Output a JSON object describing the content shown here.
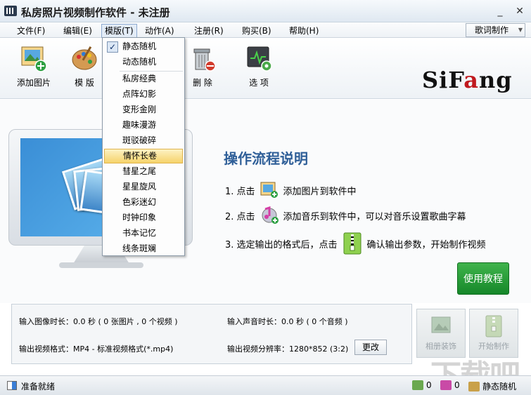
{
  "window": {
    "title": "私房照片视频制作软件 - 未注册",
    "min": "_",
    "close": "✕"
  },
  "menu": {
    "items": [
      "文件(F)",
      "编辑(E)",
      "模版(T)",
      "动作(A)",
      "注册(R)",
      "购买(B)",
      "帮助(H)"
    ],
    "lyric_button": "歌词制作"
  },
  "toolbar": {
    "add_image": "添加图片",
    "template": "模 版",
    "delete": "删 除",
    "options": "选 项"
  },
  "logo": {
    "pre": "SiF",
    "accent": "a",
    "post": "ng"
  },
  "dropdown": {
    "items": [
      "静态随机",
      "动态随机",
      "私房经典",
      "点阵幻影",
      "变形金刚",
      "趣味漫游",
      "斑驳破碎",
      "情怀长卷",
      "彗星之尾",
      "星星旋风",
      "色彩迷幻",
      "时钟印象",
      "书本记忆",
      "线条斑斓"
    ],
    "checked_index": 0,
    "highlighted_index": 7
  },
  "flow": {
    "title": "操作流程说明",
    "step1_prefix": "1. 点击",
    "step1_suffix": "添加图片到软件中",
    "step2_prefix": "2. 点击",
    "step2_suffix": "添加音乐到软件中，可以对音乐设置歌曲字幕",
    "step3_prefix": "3. 选定输出的格式后，点击",
    "step3_suffix": "确认输出参数，开始制作视频",
    "tutorial_button": "使用教程"
  },
  "info": {
    "image_duration": "输入图像时长：0.0 秒 ( 0 张图片 , 0 个视频 )",
    "audio_duration": "输入声音时长：0.0 秒 ( 0 个音频 )",
    "output_format": "输出视频格式：MP4 - 标准视频格式(*.mp4)",
    "output_resolution": "输出视频分辨率：1280*852 (3:2)",
    "change_button": "更改",
    "album_button": "相册装饰",
    "start_button": "开始制作"
  },
  "status": {
    "text": "准备就绪",
    "image_count": "0",
    "audio_count": "0",
    "mode": "静态随机"
  },
  "watermark": "下载吧",
  "colors": {
    "accent_red": "#c0191e",
    "flow_title_blue": "#2f5f98",
    "tutorial_green": "#16882a"
  }
}
